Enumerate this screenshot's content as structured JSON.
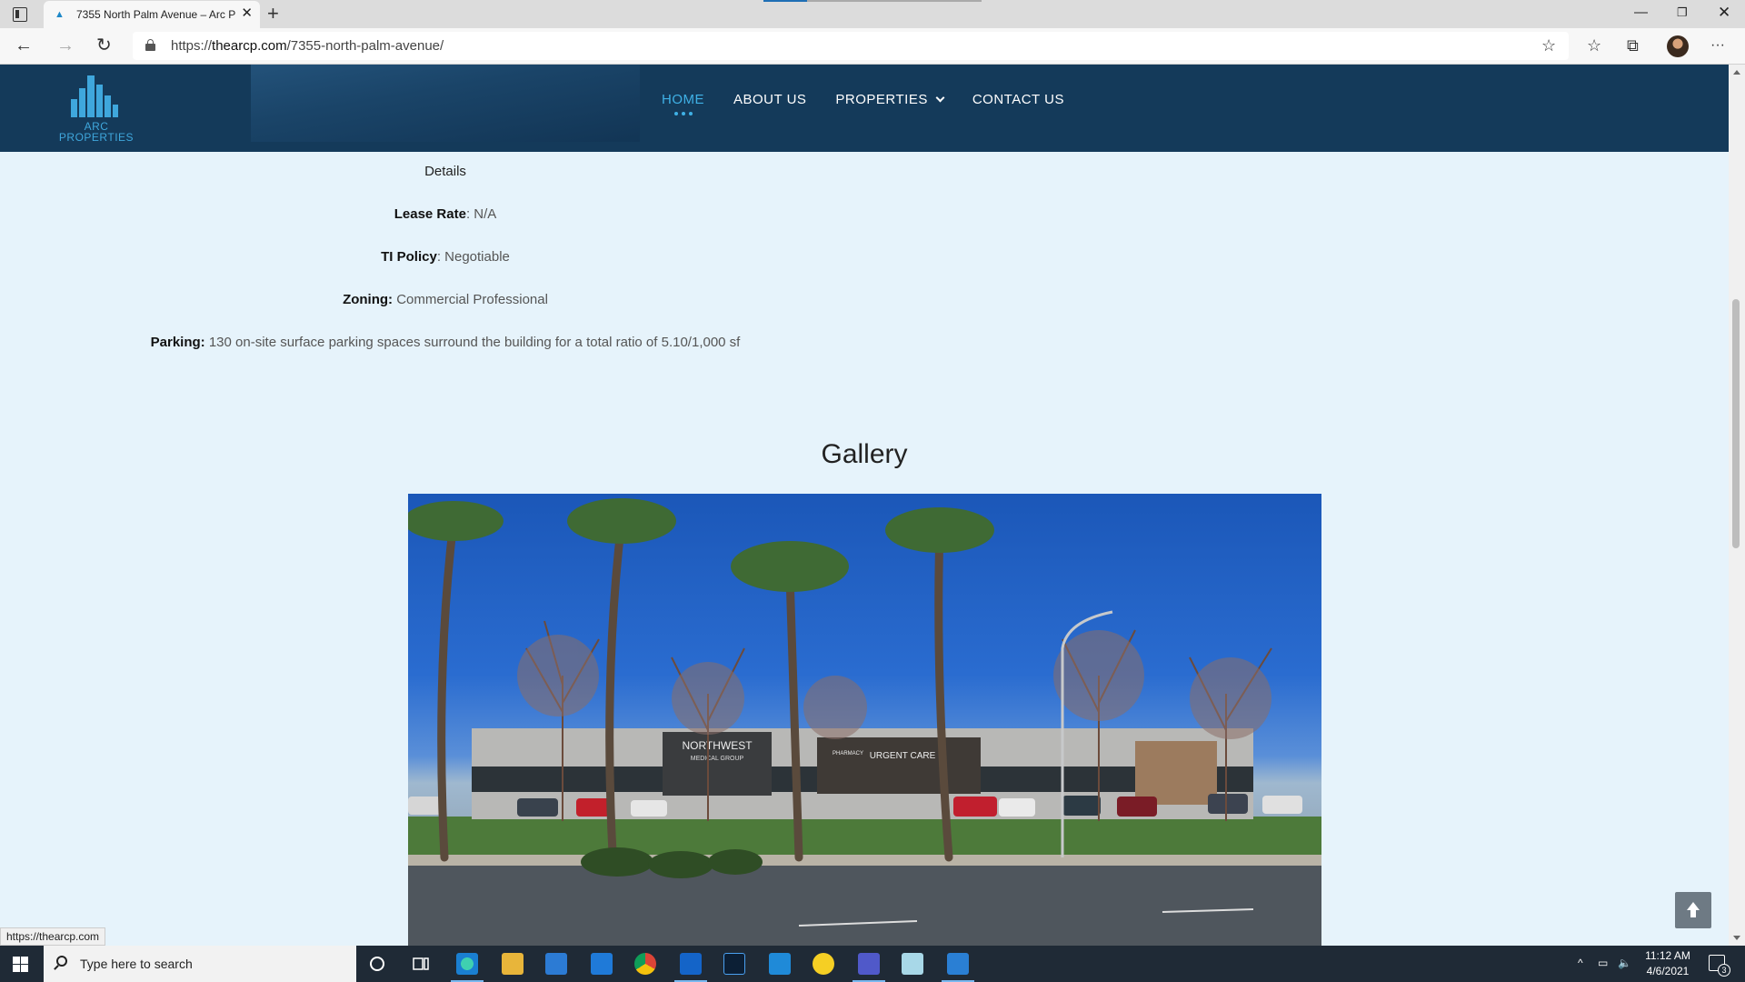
{
  "browser": {
    "tab_title": "7355 North Palm Avenue – Arc P",
    "url_scheme": "https://",
    "url_host": "thearcp.com",
    "url_path": "/7355-north-palm-avenue/",
    "status_url": "https://thearcp.com"
  },
  "site": {
    "logo_line1": "ARC",
    "logo_line2": "PROPERTIES",
    "nav": {
      "home": "HOME",
      "about": "ABOUT US",
      "properties": "PROPERTIES",
      "contact": "CONTACT US"
    }
  },
  "details": {
    "heading": "Details",
    "lease_rate_label": "Lease Rate",
    "lease_rate_value": ": N/A",
    "ti_policy_label": "TI Policy",
    "ti_policy_value": ": Negotiable",
    "zoning_label": "Zoning:",
    "zoning_value": " Commercial Professional",
    "parking_label": "Parking:",
    "parking_value": " 130 on-site surface parking spaces surround the building for a total ratio of 5.10/1,000 sf"
  },
  "gallery": {
    "title": "Gallery",
    "building_sign": "NORTHWEST",
    "building_sign_sub": "MEDICAL GROUP",
    "pharmacy_sign": "PHARMACY",
    "urgent_sign": "URGENT CARE"
  },
  "taskbar": {
    "search_placeholder": "Type here to search",
    "time": "11:12 AM",
    "date": "4/6/2021",
    "notifications": "3"
  },
  "colors": {
    "header_bg": "#143a5a",
    "accent": "#3fb1e6",
    "page_bg": "#e6f3fb"
  }
}
